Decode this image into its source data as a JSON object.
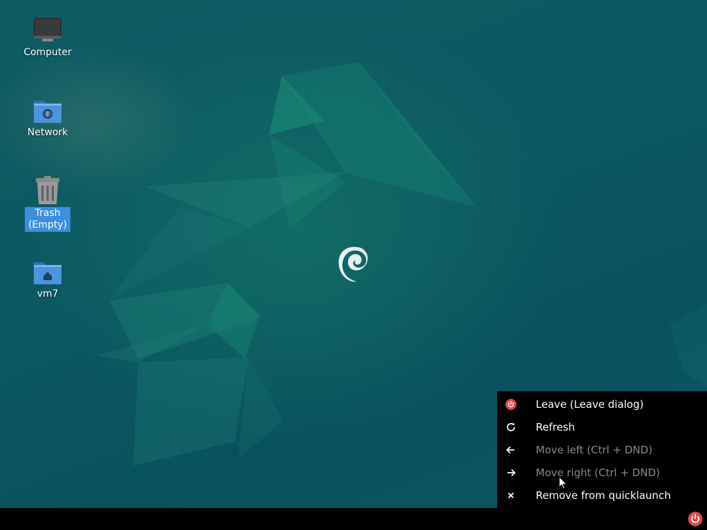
{
  "desktop": {
    "icons": [
      {
        "label": "Computer",
        "icon": "computer-icon",
        "selected": false
      },
      {
        "label": "Network",
        "icon": "network-folder-icon",
        "selected": false
      },
      {
        "label": "Trash\n(Empty)",
        "icon": "trash-icon",
        "selected": true
      },
      {
        "label": "vm7",
        "icon": "home-folder-icon",
        "selected": false
      }
    ],
    "wallpaper_logo": "debian-swirl-logo"
  },
  "context_menu": {
    "items": [
      {
        "label": "Leave (Leave dialog)",
        "icon": "power-icon",
        "enabled": true
      },
      {
        "label": "Refresh",
        "icon": "refresh-icon",
        "enabled": true
      },
      {
        "label": "Move left (Ctrl + DND)",
        "icon": "arrow-left-icon",
        "enabled": false
      },
      {
        "label": "Move right (Ctrl + DND)",
        "icon": "arrow-right-icon",
        "enabled": false
      },
      {
        "label": "Remove from quicklaunch",
        "icon": "close-icon",
        "enabled": true
      }
    ]
  },
  "panel": {
    "quicklaunch": [
      {
        "icon": "power-icon"
      }
    ]
  },
  "colors": {
    "selection": "#3d8ee0",
    "power_red": "#e0474c",
    "menu_bg": "#000000",
    "disabled_text": "#8a8a8a"
  }
}
